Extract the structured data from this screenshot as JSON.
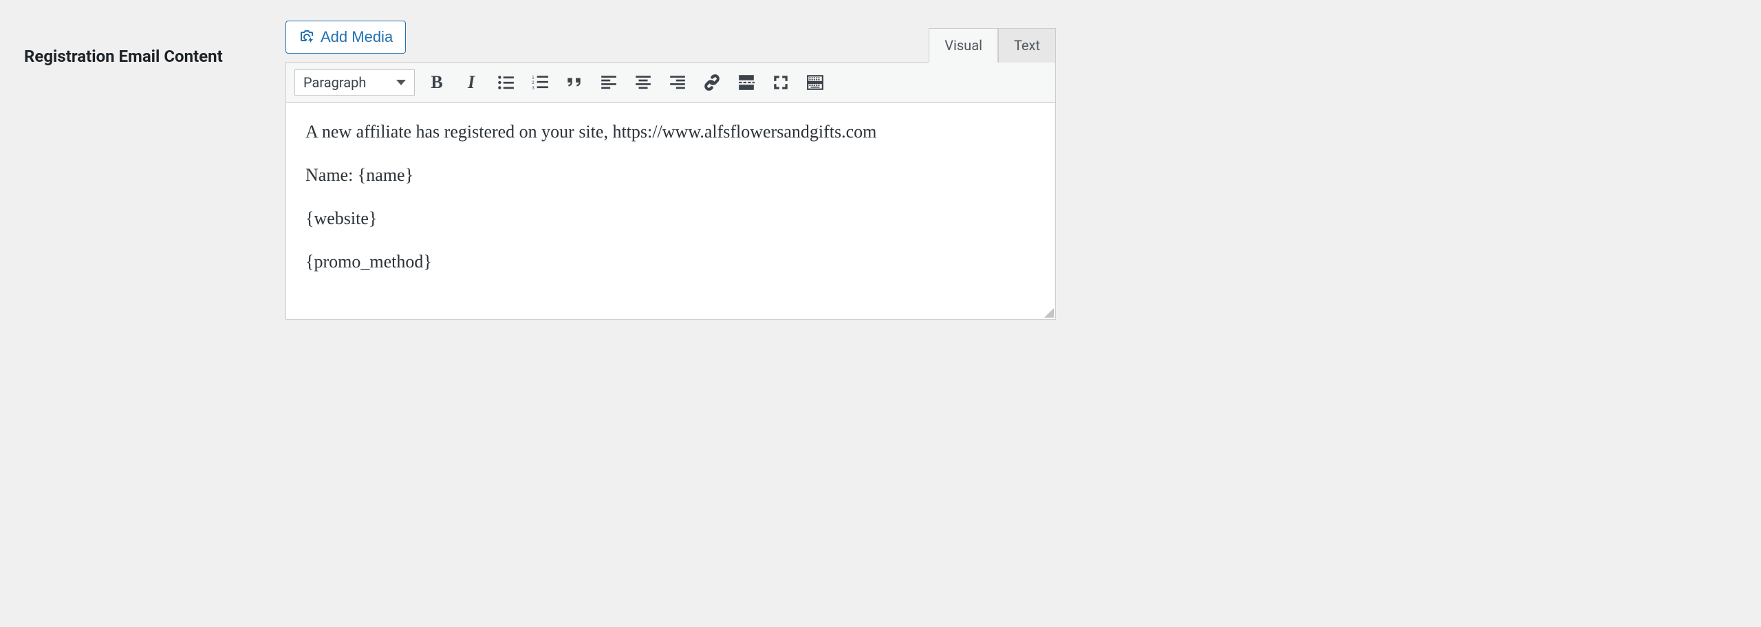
{
  "field": {
    "label": "Registration Email Content"
  },
  "editor": {
    "add_media_label": "Add Media",
    "tabs": {
      "visual": "Visual",
      "text": "Text",
      "active": "visual"
    },
    "format_selector": {
      "label": "Paragraph"
    },
    "toolbar": {
      "bold": "B",
      "italic": "I"
    },
    "content": {
      "p1": "A new affiliate has registered on your site, https://www.alfsflowersandgifts.com",
      "p2": "Name: {name}",
      "p3": "{website}",
      "p4": "{promo_method}"
    }
  }
}
